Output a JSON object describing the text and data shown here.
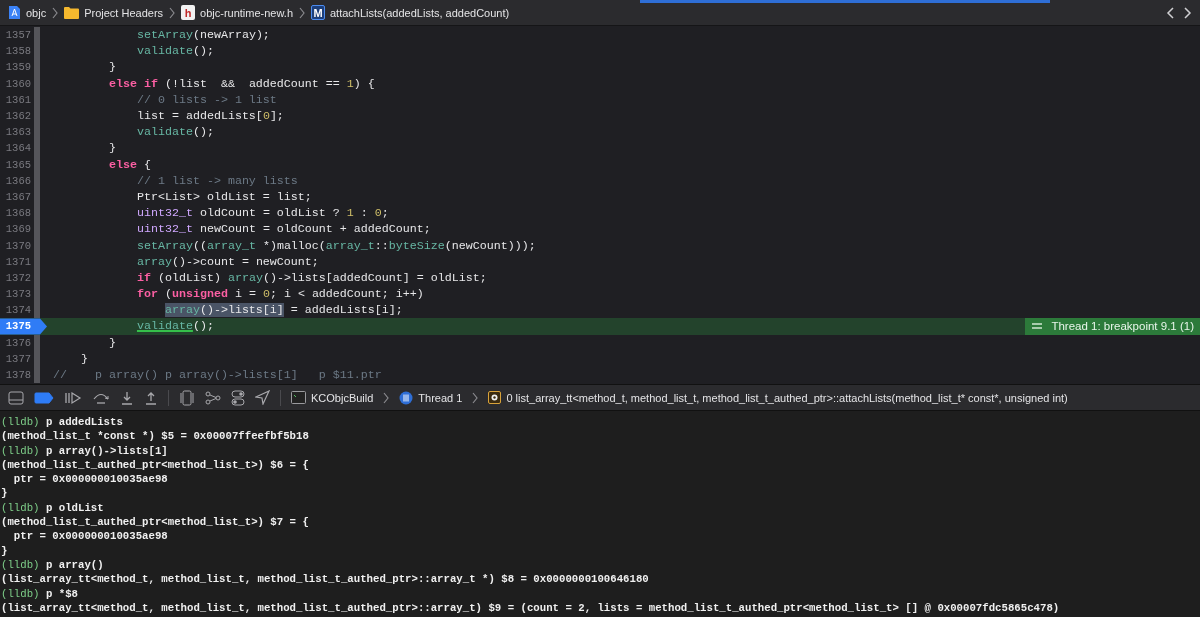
{
  "breadcrumb": {
    "items": [
      {
        "kind": "project",
        "label": "objc"
      },
      {
        "kind": "folder",
        "label": "Project Headers"
      },
      {
        "kind": "header",
        "badge": "h",
        "label": "objc-runtime-new.h"
      },
      {
        "kind": "method",
        "badge": "M",
        "label": "attachLists(addedLists, addedCount)"
      }
    ]
  },
  "editor": {
    "lines": [
      {
        "number": "1357",
        "current": false,
        "segments": [
          {
            "kind": "fn",
            "text": "            setArray"
          },
          {
            "kind": "plain",
            "text": "(newArray);"
          }
        ]
      },
      {
        "number": "1358",
        "current": false,
        "segments": [
          {
            "kind": "fn",
            "text": "            validate"
          },
          {
            "kind": "plain",
            "text": "();"
          }
        ]
      },
      {
        "number": "1359",
        "current": false,
        "segments": [
          {
            "kind": "plain",
            "text": "        }"
          }
        ]
      },
      {
        "number": "1360",
        "current": false,
        "segments": [
          {
            "kind": "kw",
            "text": "        else if"
          },
          {
            "kind": "plain",
            "text": " (!list  &&  addedCount == "
          },
          {
            "kind": "num",
            "text": "1"
          },
          {
            "kind": "plain",
            "text": ") {"
          }
        ]
      },
      {
        "number": "1361",
        "current": false,
        "segments": [
          {
            "kind": "comment",
            "text": "            // 0 lists -> 1 list"
          }
        ]
      },
      {
        "number": "1362",
        "current": false,
        "segments": [
          {
            "kind": "plain",
            "text": "            list = addedLists["
          },
          {
            "kind": "num",
            "text": "0"
          },
          {
            "kind": "plain",
            "text": "];"
          }
        ]
      },
      {
        "number": "1363",
        "current": false,
        "segments": [
          {
            "kind": "fn",
            "text": "            validate"
          },
          {
            "kind": "plain",
            "text": "();"
          }
        ]
      },
      {
        "number": "1364",
        "current": false,
        "segments": [
          {
            "kind": "plain",
            "text": "        }"
          }
        ]
      },
      {
        "number": "1365",
        "current": false,
        "segments": [
          {
            "kind": "kw",
            "text": "        else"
          },
          {
            "kind": "plain",
            "text": " {"
          }
        ]
      },
      {
        "number": "1366",
        "current": false,
        "segments": [
          {
            "kind": "comment",
            "text": "            // 1 list -> many lists"
          }
        ]
      },
      {
        "number": "1367",
        "current": false,
        "segments": [
          {
            "kind": "plain",
            "text": "            Ptr<List> oldList = list;"
          }
        ]
      },
      {
        "number": "1368",
        "current": false,
        "segments": [
          {
            "kind": "type",
            "text": "            uint32_t"
          },
          {
            "kind": "plain",
            "text": " oldCount = oldList ? "
          },
          {
            "kind": "num",
            "text": "1"
          },
          {
            "kind": "plain",
            "text": " : "
          },
          {
            "kind": "num",
            "text": "0"
          },
          {
            "kind": "plain",
            "text": ";"
          }
        ]
      },
      {
        "number": "1369",
        "current": false,
        "segments": [
          {
            "kind": "type",
            "text": "            uint32_t"
          },
          {
            "kind": "plain",
            "text": " newCount = oldCount + addedCount;"
          }
        ]
      },
      {
        "number": "1370",
        "current": false,
        "segments": [
          {
            "kind": "fn",
            "text": "            setArray"
          },
          {
            "kind": "plain",
            "text": "(("
          },
          {
            "kind": "fn",
            "text": "array_t"
          },
          {
            "kind": "plain",
            "text": " *)malloc("
          },
          {
            "kind": "fn",
            "text": "array_t"
          },
          {
            "kind": "plain",
            "text": "::"
          },
          {
            "kind": "fn",
            "text": "byteSize"
          },
          {
            "kind": "plain",
            "text": "(newCount)));"
          }
        ]
      },
      {
        "number": "1371",
        "current": false,
        "segments": [
          {
            "kind": "fn",
            "text": "            array"
          },
          {
            "kind": "plain",
            "text": "()->count = newCount;"
          }
        ]
      },
      {
        "number": "1372",
        "current": false,
        "segments": [
          {
            "kind": "kw",
            "text": "            if"
          },
          {
            "kind": "plain",
            "text": " (oldList) "
          },
          {
            "kind": "fn",
            "text": "array"
          },
          {
            "kind": "plain",
            "text": "()->lists[addedCount] = oldList;"
          }
        ]
      },
      {
        "number": "1373",
        "current": false,
        "segments": [
          {
            "kind": "kw",
            "text": "            for"
          },
          {
            "kind": "plain",
            "text": " ("
          },
          {
            "kind": "kw",
            "text": "unsigned"
          },
          {
            "kind": "plain",
            "text": " i = "
          },
          {
            "kind": "num",
            "text": "0"
          },
          {
            "kind": "plain",
            "text": "; i < addedCount; i++)"
          }
        ]
      },
      {
        "number": "1374",
        "current": false,
        "segments": [
          {
            "kind": "selfn",
            "text": "                array"
          },
          {
            "kind": "selplain",
            "text": "()->lists[i]"
          },
          {
            "kind": "plain",
            "text": " = addedLists[i];"
          }
        ]
      },
      {
        "number": "1375",
        "current": true,
        "segments": [
          {
            "kind": "underlined",
            "text": "            validate"
          },
          {
            "kind": "plain",
            "text": "();"
          }
        ]
      },
      {
        "number": "1376",
        "current": false,
        "segments": [
          {
            "kind": "plain",
            "text": "        }"
          }
        ]
      },
      {
        "number": "1377",
        "current": false,
        "segments": [
          {
            "kind": "plain",
            "text": "    }"
          }
        ]
      },
      {
        "number": "1378",
        "current": false,
        "segments": [
          {
            "kind": "comment",
            "text": "//    p array() p array()->lists[1]   p $11.ptr"
          }
        ]
      }
    ],
    "breakpoint_badge": "Thread 1: breakpoint 9.1 (1)"
  },
  "debug_bar": {
    "breakpoints_active": true,
    "scheme": "KCObjcBuild",
    "thread": "Thread 1",
    "frame": "0 list_array_tt<method_t, method_list_t, method_list_t_authed_ptr>::attachLists(method_list_t* const*, unsigned int)"
  },
  "console": {
    "lines": [
      {
        "kind": "prompt",
        "prompt": "(lldb)",
        "text": "p addedLists"
      },
      {
        "kind": "output",
        "text": "(method_list_t *const *) $5 = 0x00007ffeefbf5b18"
      },
      {
        "kind": "prompt",
        "prompt": "(lldb)",
        "text": "p array()->lists[1]"
      },
      {
        "kind": "output",
        "text": "(method_list_t_authed_ptr<method_list_t>) $6 = {"
      },
      {
        "kind": "output",
        "text": "  ptr = 0x000000010035ae98"
      },
      {
        "kind": "output",
        "text": "}"
      },
      {
        "kind": "prompt",
        "prompt": "(lldb)",
        "text": "p oldList"
      },
      {
        "kind": "output",
        "text": "(method_list_t_authed_ptr<method_list_t>) $7 = {"
      },
      {
        "kind": "output",
        "text": "  ptr = 0x000000010035ae98"
      },
      {
        "kind": "output",
        "text": "}"
      },
      {
        "kind": "prompt",
        "prompt": "(lldb)",
        "text": "p array()"
      },
      {
        "kind": "output",
        "text": "(list_array_tt<method_t, method_list_t, method_list_t_authed_ptr>::array_t *) $8 = 0x0000000100646180"
      },
      {
        "kind": "prompt",
        "prompt": "(lldb)",
        "text": "p *$8"
      },
      {
        "kind": "output",
        "text": "(list_array_tt<method_t, method_list_t, method_list_t_authed_ptr>::array_t) $9 = (count = 2, lists = method_list_t_authed_ptr<method_list_t> [] @ 0x00007fdc5865c478)"
      }
    ]
  }
}
